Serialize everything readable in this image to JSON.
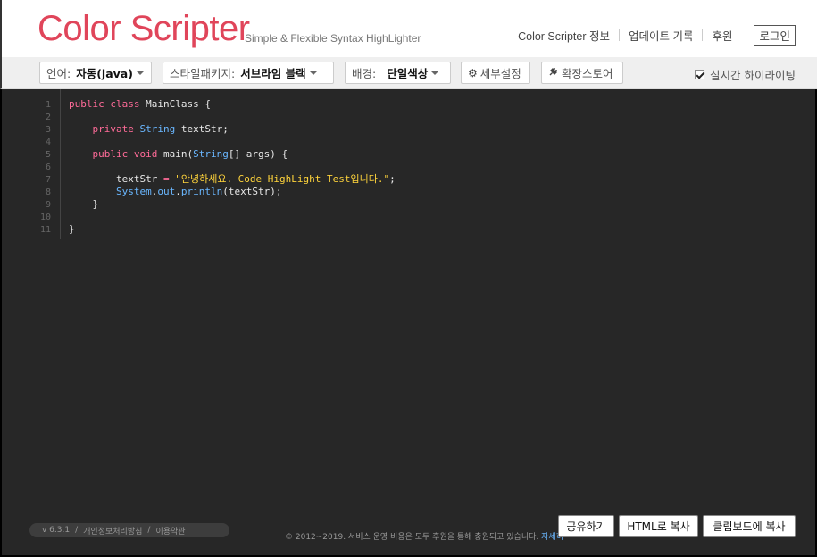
{
  "header": {
    "logo": "Color Scripter",
    "tagline": "Simple & Flexible Syntax HighLighter",
    "nav": [
      "Color Scripter 정보",
      "업데이트 기록",
      "후원"
    ],
    "login": "로그인"
  },
  "toolbar": {
    "lang_label": "언어:",
    "lang_value": "자동(java)",
    "style_label": "스타일패키지:",
    "style_value": "서브라임 블랙",
    "bg_label": "배경:",
    "bg_value": "단일색상",
    "detail": "세부설정",
    "extension": "확장스토어",
    "realtime": "실시간 하이라이팅",
    "realtime_checked": true
  },
  "code": {
    "line_numbers": [
      "1",
      "2",
      "3",
      "4",
      "5",
      "6",
      "7",
      "8",
      "9",
      "10",
      "11"
    ],
    "lines": [
      [
        {
          "t": "public",
          "c": "kw"
        },
        {
          "t": " "
        },
        {
          "t": "class",
          "c": "kw"
        },
        {
          "t": " MainClass {"
        }
      ],
      [],
      [
        {
          "t": "    "
        },
        {
          "t": "private",
          "c": "kw"
        },
        {
          "t": " "
        },
        {
          "t": "String",
          "c": "ty"
        },
        {
          "t": " textStr;"
        }
      ],
      [],
      [
        {
          "t": "    "
        },
        {
          "t": "public",
          "c": "kw"
        },
        {
          "t": " "
        },
        {
          "t": "void",
          "c": "kw"
        },
        {
          "t": " main("
        },
        {
          "t": "String",
          "c": "ty"
        },
        {
          "t": "[] args) {"
        }
      ],
      [],
      [
        {
          "t": "        textStr "
        },
        {
          "t": "=",
          "c": "op"
        },
        {
          "t": " "
        },
        {
          "t": "\"안녕하세요. Code HighLight Test입니다.\"",
          "c": "str"
        },
        {
          "t": ";"
        }
      ],
      [
        {
          "t": "        "
        },
        {
          "t": "System",
          "c": "ty"
        },
        {
          "t": "."
        },
        {
          "t": "out",
          "c": "ty"
        },
        {
          "t": "."
        },
        {
          "t": "println",
          "c": "ty"
        },
        {
          "t": "(textStr);"
        }
      ],
      [
        {
          "t": "    }"
        }
      ],
      [],
      [
        {
          "t": "}"
        }
      ]
    ]
  },
  "footer": {
    "version": "v 6.3.1",
    "privacy": "개인정보처리방침",
    "terms": "이용약관",
    "copyright": "© 2012~2019. 서비스 운영 비용은 모두 후원을 통해 충원되고 있습니다.",
    "more": "자세히",
    "share": "공유하기",
    "html_copy": "HTML로 복사",
    "clipboard_copy": "클립보드에 복사"
  },
  "colors": {
    "logo": "#e0455a",
    "editor_bg": "#272727",
    "keyword": "#ff6b98",
    "type": "#6ab7ff",
    "string": "#ffd43b"
  }
}
